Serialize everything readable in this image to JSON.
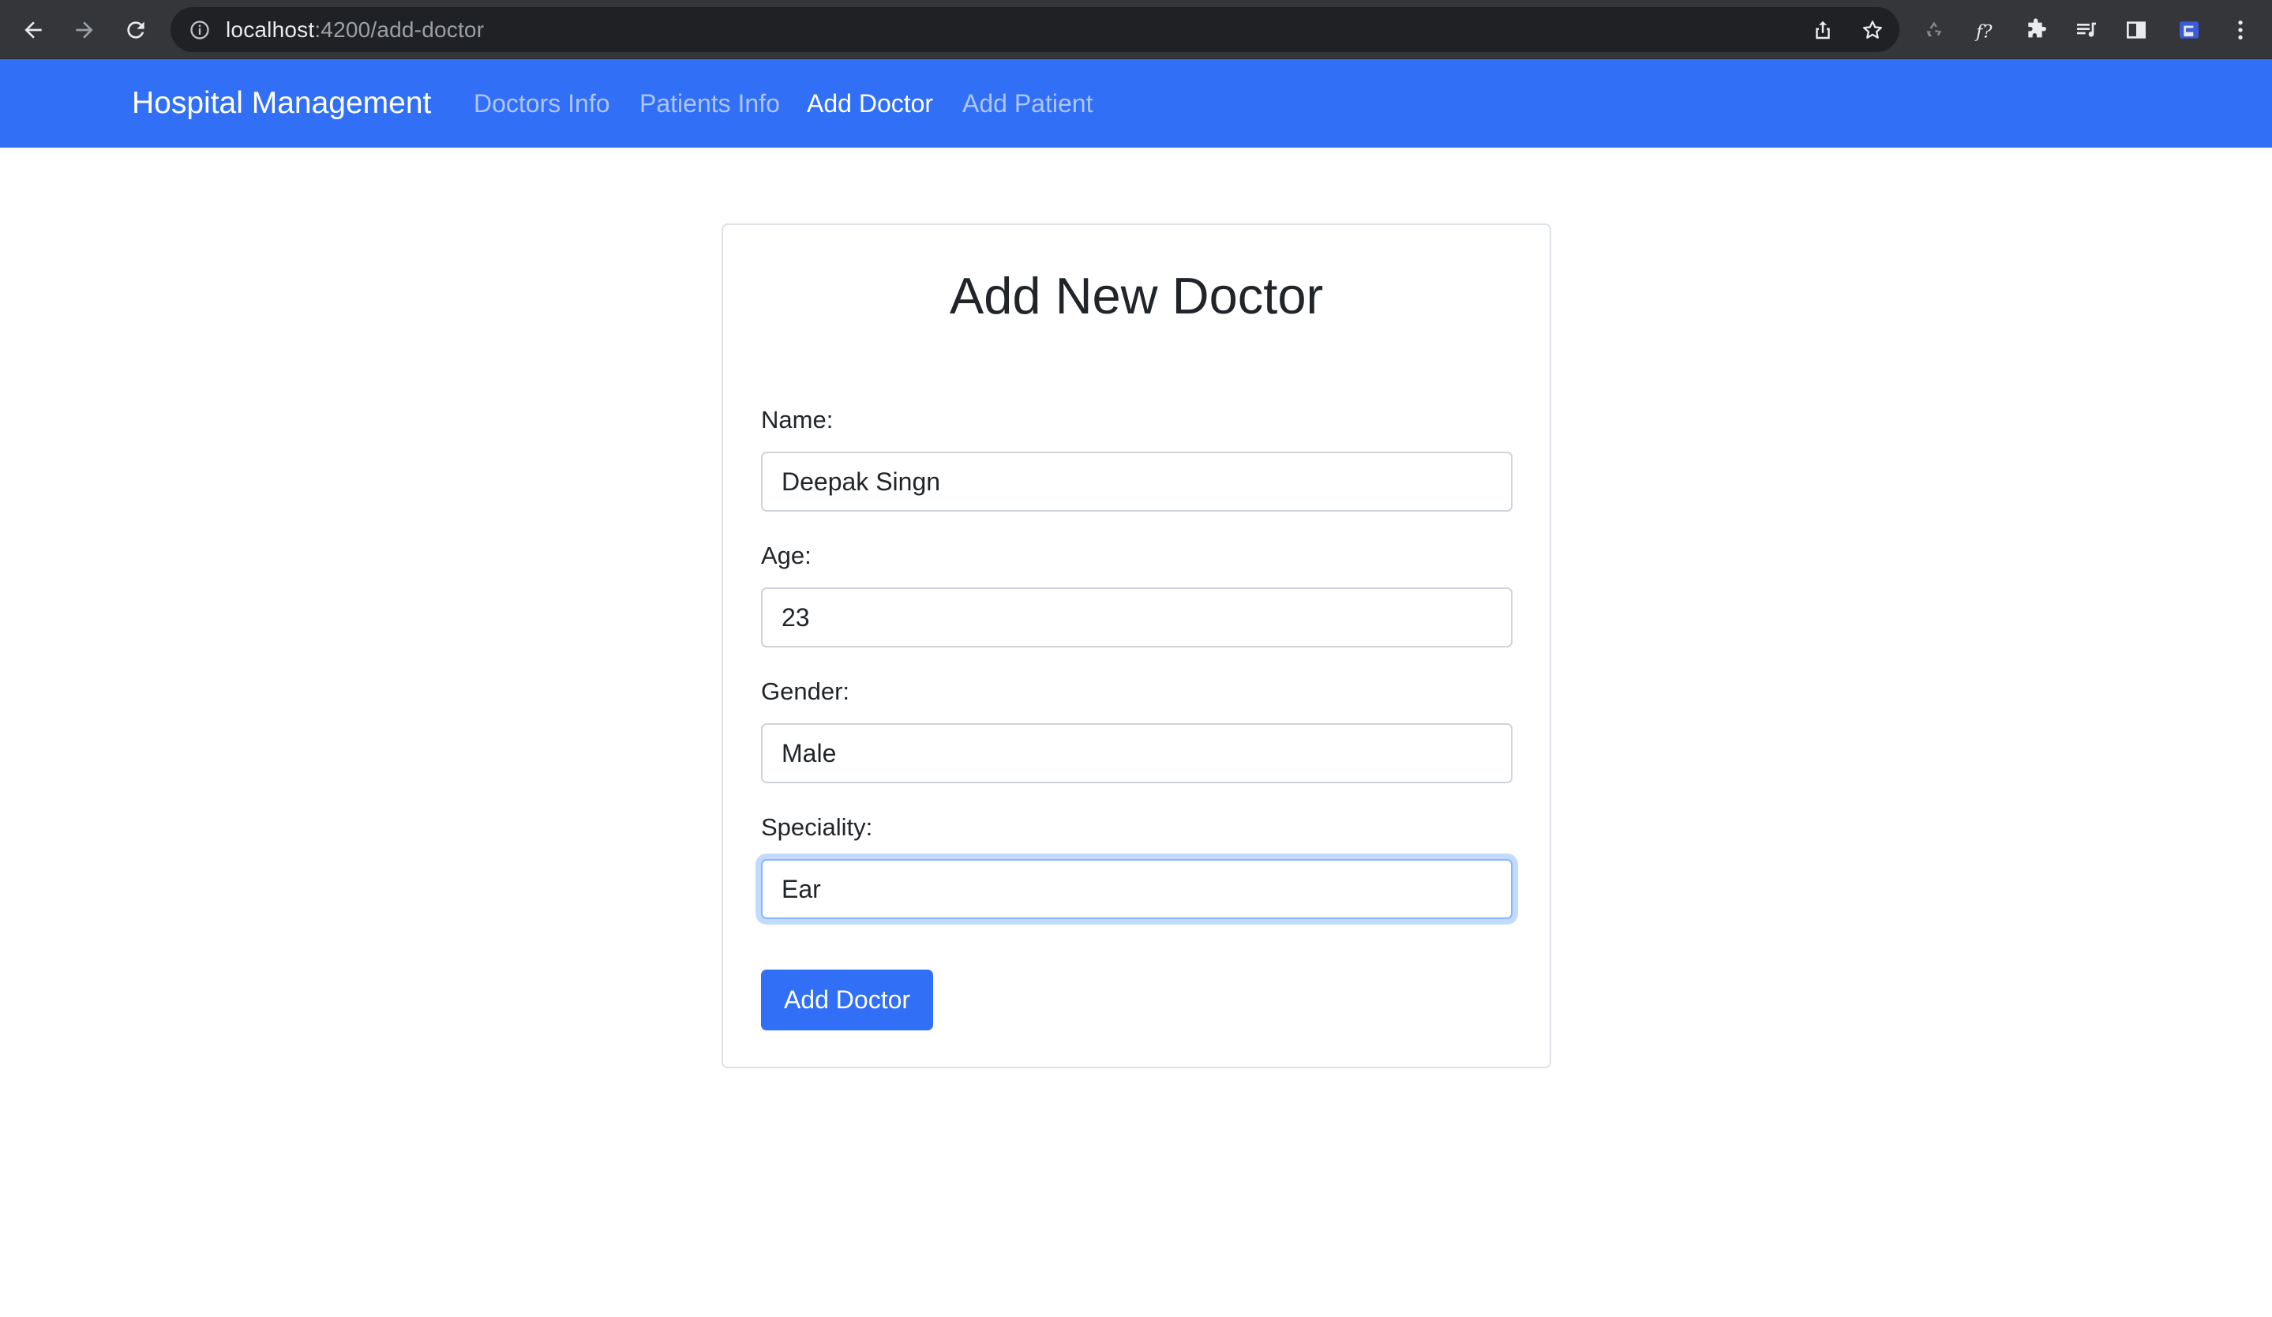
{
  "browser": {
    "url_host": "localhost",
    "url_path": ":4200/add-doctor",
    "icons": [
      "back-arrow-icon",
      "forward-arrow-icon",
      "reload-icon",
      "info-icon",
      "share-icon",
      "star-icon",
      "recycle-icon",
      "function-icon",
      "puzzle-icon",
      "media-queue-icon",
      "side-panel-icon",
      "profile-icon",
      "kebab-menu-icon"
    ]
  },
  "navbar": {
    "brand": "Hospital Management",
    "links": [
      {
        "label": "Doctors Info",
        "active": false
      },
      {
        "label": "Patients Info",
        "active": false
      },
      {
        "label": "Add Doctor",
        "active": true
      },
      {
        "label": "Add Patient",
        "active": false
      }
    ]
  },
  "form": {
    "title": "Add New Doctor",
    "fields": [
      {
        "label": "Name:",
        "value": "Deepak Singn"
      },
      {
        "label": "Age:",
        "value": "23"
      },
      {
        "label": "Gender:",
        "value": "Male"
      },
      {
        "label": "Speciality:",
        "value": "Ear"
      }
    ],
    "submit_label": "Add Doctor"
  },
  "colors": {
    "primary": "#316ff6",
    "chrome_bg": "#35363a",
    "omnibox_bg": "#202124",
    "focus_ring": "#86b7fe"
  }
}
